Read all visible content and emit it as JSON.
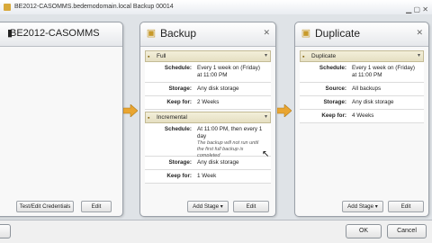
{
  "window": {
    "title": "BE2012-CASOMMS.bedemodomain.local Backup 00014"
  },
  "panels": {
    "server": {
      "title": "BE2012-CASOMMS",
      "buttons": [
        "Test/Edit Credentials",
        "Edit"
      ]
    },
    "backup": {
      "title": "Backup",
      "full": {
        "label": "Full",
        "rows": [
          {
            "key": "Schedule:",
            "value": "Every 1 week on (Friday) at 11:00 PM"
          },
          {
            "key": "Storage:",
            "value": "Any disk storage"
          },
          {
            "key": "Keep for:",
            "value": "2 Weeks"
          }
        ]
      },
      "incremental": {
        "label": "Incremental",
        "rows": [
          {
            "key": "Schedule:",
            "value": "At 11:00 PM, then every 1 day",
            "note": "The backup will not run until the first full backup is completed"
          },
          {
            "key": "Storage:",
            "value": "Any disk storage"
          },
          {
            "key": "Keep for:",
            "value": "1 Week"
          }
        ]
      },
      "buttons": {
        "add_stage": "Add Stage",
        "edit": "Edit"
      }
    },
    "duplicate": {
      "title": "Duplicate",
      "section": {
        "label": "Duplicate",
        "rows": [
          {
            "key": "Schedule:",
            "value": "Every 1 week on (Friday) at 11:00 PM"
          },
          {
            "key": "Source:",
            "value": "All backups"
          },
          {
            "key": "Storage:",
            "value": "Any disk storage"
          },
          {
            "key": "Keep for:",
            "value": "4 Weeks"
          }
        ]
      },
      "buttons": {
        "add_stage": "Add Stage",
        "edit": "Edit"
      }
    }
  },
  "footer": {
    "left_button": "lp",
    "ok": "OK",
    "cancel": "Cancel"
  },
  "colors": {
    "arrow": "#e9a531",
    "section": "#e5dfc2"
  }
}
